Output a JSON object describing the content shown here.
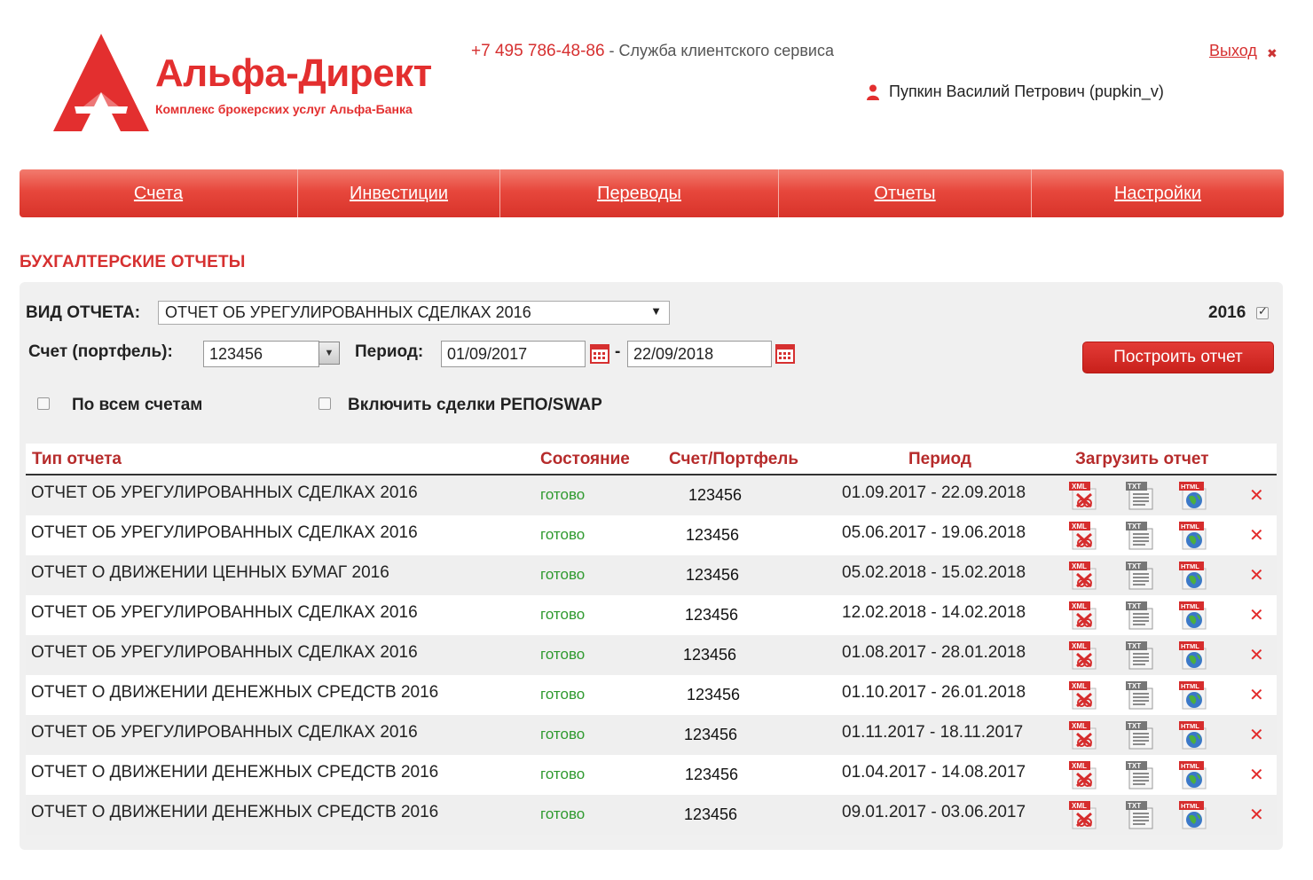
{
  "header": {
    "logo_title": "Альфа-Директ",
    "logo_subtitle": "Комплекс брокерских услуг Альфа-Банка",
    "phone": "+7 495 786-48-86",
    "phone_separator": " - ",
    "phone_desc": "Служба клиентского сервиса",
    "logout": "Выход",
    "user": "Пупкин Василий Петрович (pupkin_v)"
  },
  "nav": [
    {
      "label": "Счета"
    },
    {
      "label": "Инвестиции"
    },
    {
      "label": "Переводы"
    },
    {
      "label": "Отчеты"
    },
    {
      "label": "Настройки"
    }
  ],
  "page_title": "БУХГАЛТЕРСКИЕ ОТЧЕТЫ",
  "form": {
    "report_type_label": "ВИД ОТЧЕТА:",
    "report_type_value": "ОТЧЕТ ОБ УРЕГУЛИРОВАННЫХ СДЕЛКАХ 2016",
    "year_label": "2016",
    "year_checked": true,
    "account_label": "Счет (портфель):",
    "account_value": "123456",
    "period_label": "Период:",
    "date_from": "01/09/2017",
    "date_sep": "-",
    "date_to": "22/09/2018",
    "build_button": "Построить отчет",
    "all_accounts_label": "По всем счетам",
    "all_accounts_checked": false,
    "repo_label": "Включить сделки РЕПО/SWAP",
    "repo_checked": false
  },
  "table": {
    "headers": {
      "type": "Тип отчета",
      "state": "Состояние",
      "account": "Счет/Портфель",
      "period": "Период",
      "download": "Загрузить отчет"
    },
    "rows": [
      {
        "type": "ОТЧЕТ ОБ УРЕГУЛИРОВАННЫХ СДЕЛКАХ 2016",
        "state": "готово",
        "account": "123456",
        "period": "01.09.2017 - 22.09.2018"
      },
      {
        "type": "ОТЧЕТ ОБ УРЕГУЛИРОВАННЫХ СДЕЛКАХ 2016",
        "state": "готово",
        "account": "123456",
        "period": "05.06.2017 - 19.06.2018"
      },
      {
        "type": "ОТЧЕТ О ДВИЖЕНИИ ЦЕННЫХ БУМАГ 2016",
        "state": "готово",
        "account": "123456",
        "period": "05.02.2018 - 15.02.2018"
      },
      {
        "type": "ОТЧЕТ ОБ УРЕГУЛИРОВАННЫХ СДЕЛКАХ 2016",
        "state": "готово",
        "account": "123456",
        "period": "12.02.2018 - 14.02.2018"
      },
      {
        "type": "ОТЧЕТ ОБ УРЕГУЛИРОВАННЫХ СДЕЛКАХ 2016",
        "state": "готово",
        "account": "123456",
        "period": "01.08.2017 - 28.01.2018"
      },
      {
        "type": "ОТЧЕТ О ДВИЖЕНИИ ДЕНЕЖНЫХ СРЕДСТВ 2016",
        "state": "готово",
        "account": "123456",
        "period": "01.10.2017 - 26.01.2018"
      },
      {
        "type": "ОТЧЕТ ОБ УРЕГУЛИРОВАННЫХ СДЕЛКАХ 2016",
        "state": "готово",
        "account": "123456",
        "period": "01.11.2017 - 18.11.2017"
      },
      {
        "type": "ОТЧЕТ О ДВИЖЕНИИ ДЕНЕЖНЫХ СРЕДСТВ 2016",
        "state": "готово",
        "account": "123456",
        "period": "01.04.2017 - 14.08.2017"
      },
      {
        "type": "ОТЧЕТ О ДВИЖЕНИИ ДЕНЕЖНЫХ СРЕДСТВ 2016",
        "state": "готово",
        "account": "123456",
        "period": "09.01.2017 - 03.06.2017"
      }
    ],
    "icons": {
      "xml": "XML",
      "txt": "TXT",
      "html": "HTML",
      "delete": "✕"
    }
  },
  "colors": {
    "brand": "#e32f2f",
    "status_ready": "#2f9a2f"
  }
}
